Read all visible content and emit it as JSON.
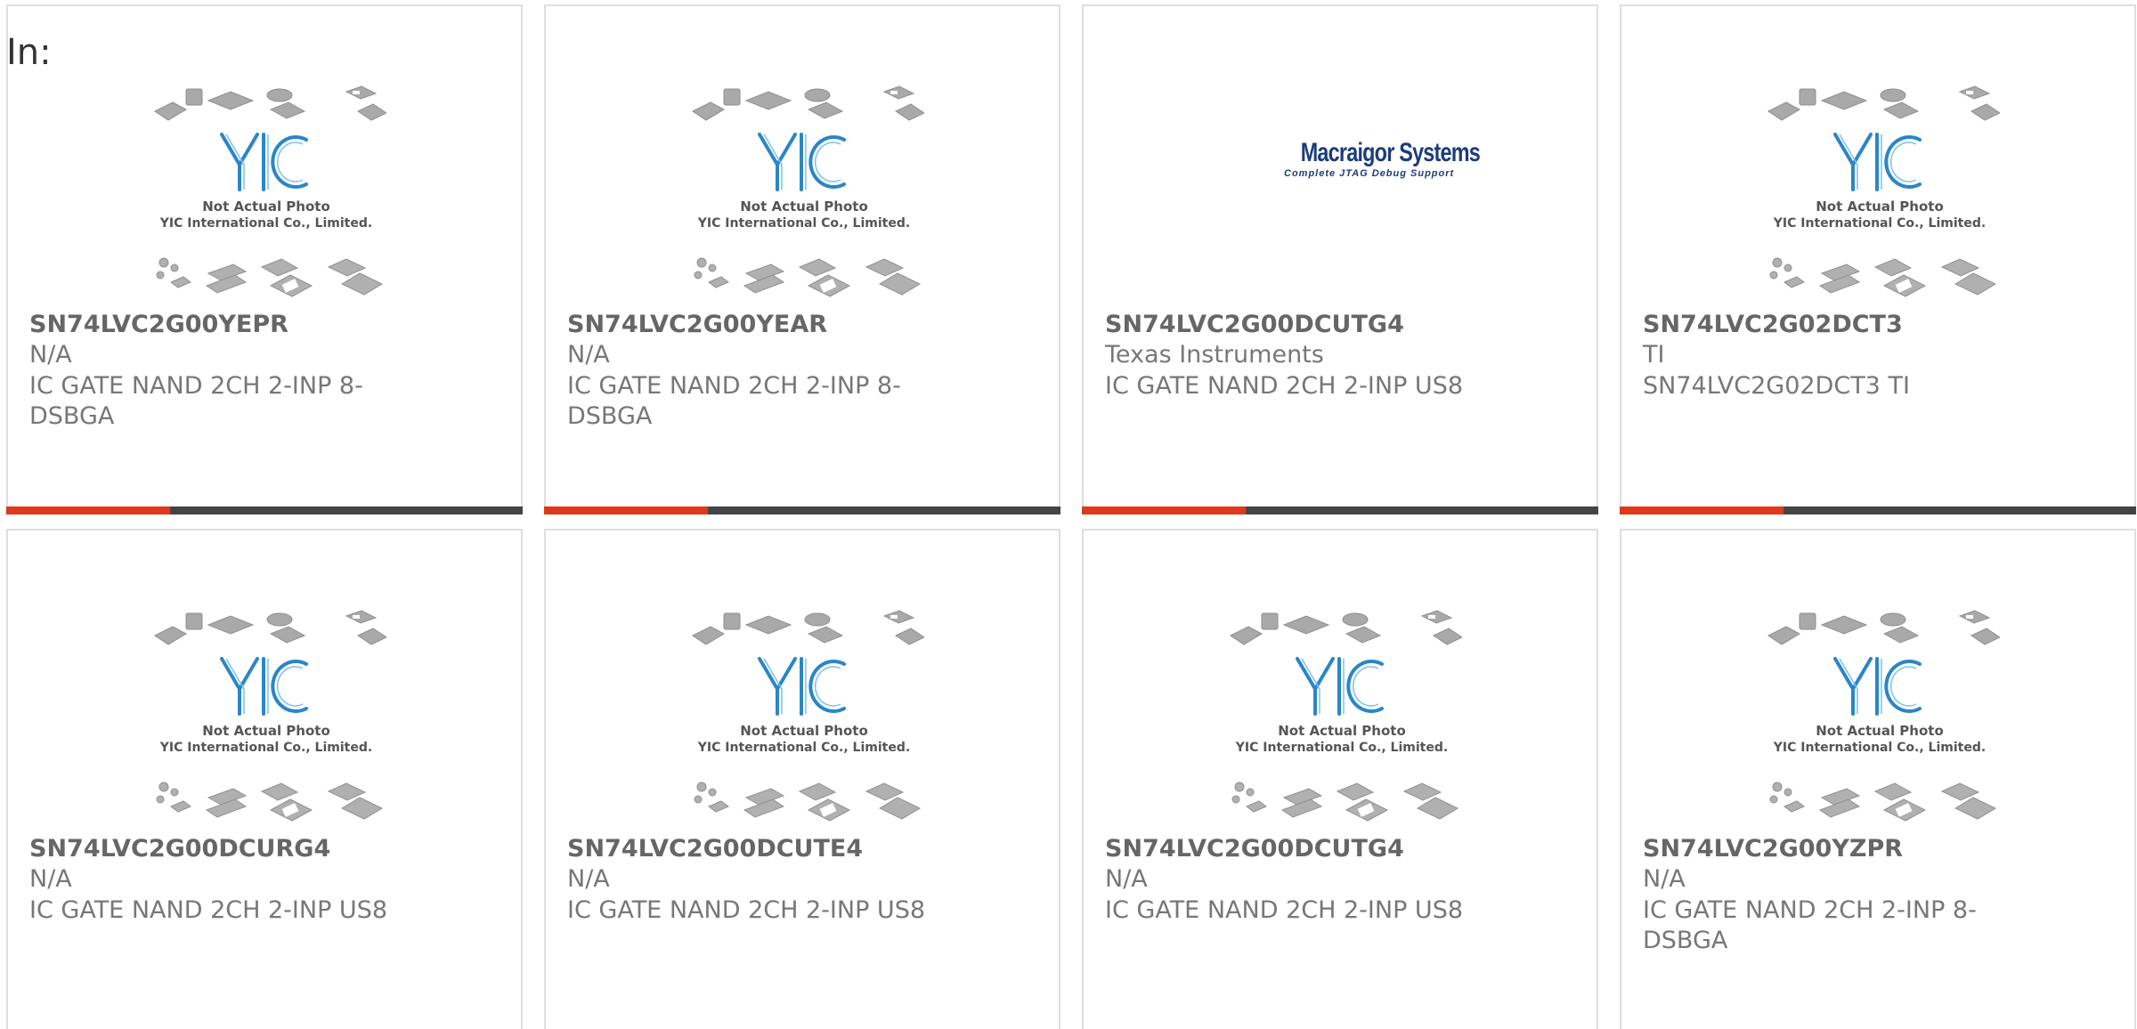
{
  "filter_label": "In:",
  "placeholder_image": {
    "line1": "Not Actual Photo",
    "line2": "YIC International Co., Limited."
  },
  "brand_logo": {
    "name": "Macraigor Systems",
    "tagline": "Complete JTAG Debug Support"
  },
  "colors": {
    "accent_red": "#e0391a",
    "accent_dark": "#444444",
    "card_border": "#dedede",
    "yic_blue": "#2a86c8"
  },
  "products": [
    {
      "part": "SN74LVC2G00YEPR",
      "manufacturer": "N/A",
      "description": "IC GATE NAND 2CH 2-INP 8-DSBGA",
      "image": "yic-placeholder"
    },
    {
      "part": "SN74LVC2G00YEAR",
      "manufacturer": "N/A",
      "description": "IC GATE NAND 2CH 2-INP 8-DSBGA",
      "image": "yic-placeholder"
    },
    {
      "part": "SN74LVC2G00DCUTG4",
      "manufacturer": "Texas Instruments",
      "description": "IC GATE NAND 2CH 2-INP US8",
      "image": "macraigor-logo"
    },
    {
      "part": "SN74LVC2G02DCT3",
      "manufacturer": "TI",
      "description": "SN74LVC2G02DCT3 TI",
      "image": "yic-placeholder"
    },
    {
      "part": "SN74LVC2G00DCURG4",
      "manufacturer": "N/A",
      "description": "IC GATE NAND 2CH 2-INP US8",
      "image": "yic-placeholder"
    },
    {
      "part": "SN74LVC2G00DCUTE4",
      "manufacturer": "N/A",
      "description": "IC GATE NAND 2CH 2-INP US8",
      "image": "yic-placeholder"
    },
    {
      "part": "SN74LVC2G00DCUTG4",
      "manufacturer": "N/A",
      "description": "IC GATE NAND 2CH 2-INP US8",
      "image": "yic-placeholder"
    },
    {
      "part": "SN74LVC2G00YZPR",
      "manufacturer": "N/A",
      "description": "IC GATE NAND 2CH 2-INP 8-DSBGA",
      "image": "yic-placeholder"
    }
  ]
}
